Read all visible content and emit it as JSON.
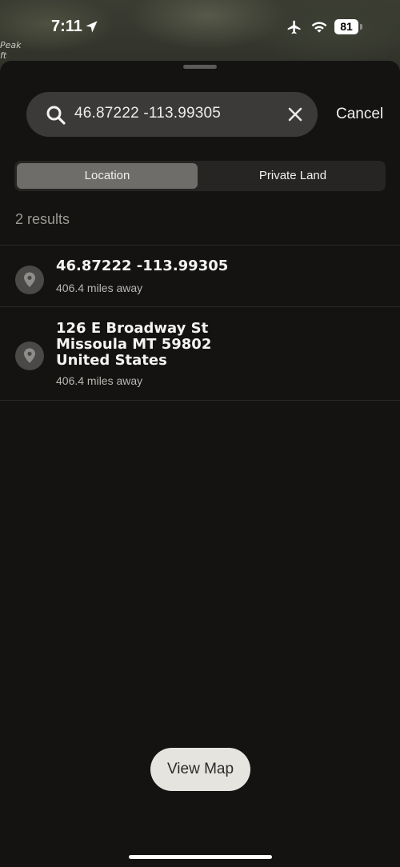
{
  "status_bar": {
    "time": "7:11",
    "battery": "81",
    "icons": [
      "location-arrow-icon",
      "airplane-icon",
      "wifi-icon",
      "battery-icon"
    ]
  },
  "map": {
    "label_line1": "Peak",
    "label_line2": "ft"
  },
  "search": {
    "value": "46.87222 -113.99305",
    "cancel_label": "Cancel"
  },
  "segments": {
    "location": "Location",
    "private_land": "Private Land",
    "selected": "Location"
  },
  "results": {
    "count_label": "2 results",
    "items": [
      {
        "title_lines": [
          "46.87222 -113.99305"
        ],
        "distance": "406.4 miles away"
      },
      {
        "title_lines": [
          "126 E Broadway St",
          "Missoula MT 59802",
          "United States"
        ],
        "distance": "406.4 miles away"
      }
    ]
  },
  "view_map_label": "View Map",
  "colors": {
    "background": "#141312",
    "search_field": "#3b3a38",
    "segment_active": "#6e6d6a",
    "button": "#e6e4df"
  }
}
